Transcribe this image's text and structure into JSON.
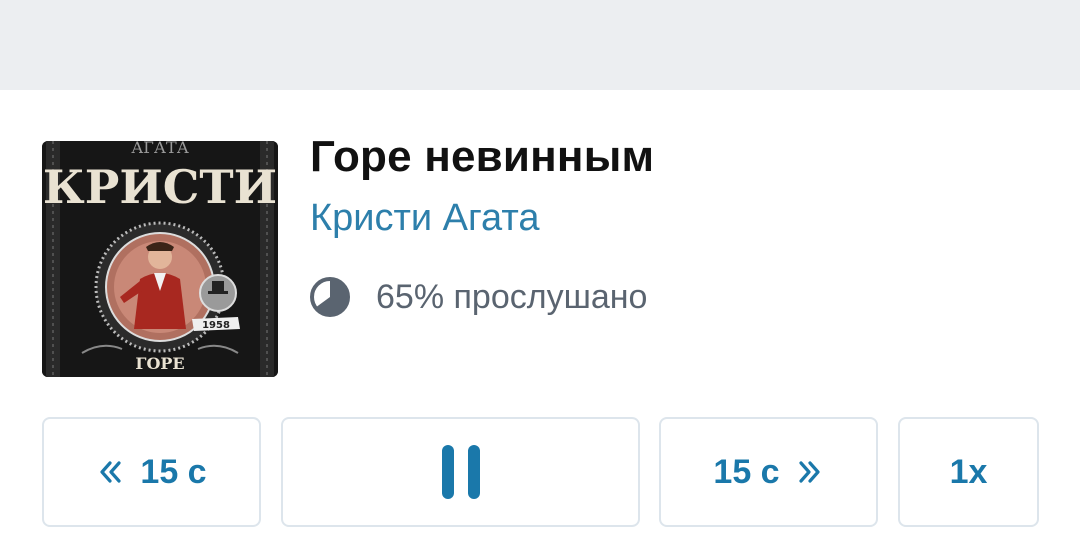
{
  "book": {
    "title": "Горе невинным",
    "author": "Кристи Агата",
    "cover": {
      "series_text": "КРИСТИ",
      "top_text": "АГАТА",
      "year": "1958",
      "bottom_text": "ГОРЕ"
    }
  },
  "progress": {
    "fraction": 0.65,
    "label": "65% прослушано",
    "icon": "pie-progress-icon"
  },
  "controls": {
    "rewind": {
      "label": "15 с",
      "icon": "double-chevron-left-icon"
    },
    "play_pause": {
      "state": "playing",
      "icon": "pause-icon"
    },
    "forward": {
      "label": "15 с",
      "icon": "double-chevron-right-icon"
    },
    "speed": {
      "label": "1x"
    }
  },
  "colors": {
    "accent": "#1a78aa",
    "author": "#2d7fab",
    "top_bar": "#eceef1",
    "border": "#dde5ec",
    "secondary_text": "#5a6470"
  }
}
